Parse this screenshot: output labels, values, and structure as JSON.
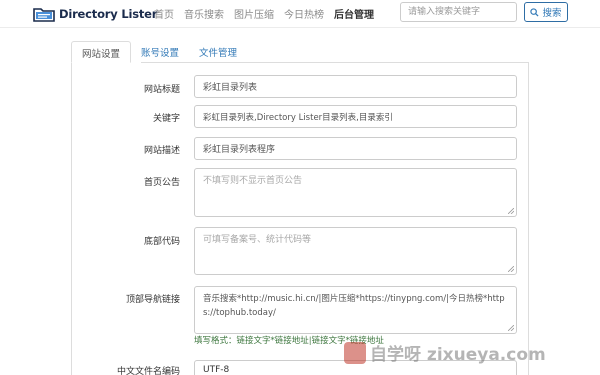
{
  "app": {
    "title": "Directory Lister"
  },
  "nav": {
    "items": [
      {
        "label": "首页",
        "active": false
      },
      {
        "label": "音乐搜索",
        "active": false
      },
      {
        "label": "图片压缩",
        "active": false
      },
      {
        "label": "今日热榜",
        "active": false
      },
      {
        "label": "后台管理",
        "active": true
      }
    ]
  },
  "search": {
    "placeholder": "请输入搜索关键字",
    "button_label": "搜索"
  },
  "tabs": [
    {
      "label": "网站设置",
      "active": true
    },
    {
      "label": "账号设置",
      "active": false
    },
    {
      "label": "文件管理",
      "active": false
    }
  ],
  "form": {
    "site_title": {
      "label": "网站标题",
      "value": "彩虹目录列表"
    },
    "keywords": {
      "label": "关键字",
      "value": "彩虹目录列表,Directory Lister目录列表,目录索引"
    },
    "description": {
      "label": "网站描述",
      "value": "彩虹目录列表程序"
    },
    "announcement": {
      "label": "首页公告",
      "placeholder": "不填写则不显示首页公告"
    },
    "footer_code": {
      "label": "底部代码",
      "placeholder": "可填写备案号、统计代码等"
    },
    "top_nav_links": {
      "label": "顶部导航链接",
      "value": "音乐搜索*http://music.hi.cn/|图片压缩*https://tinypng.com/|今日热榜*https://tophub.today/",
      "help": "填写格式：链接文字*链接地址|链接文字*链接地址"
    },
    "filename_encoding": {
      "label": "中文文件名编码",
      "value": "UTF-8"
    }
  },
  "watermark": {
    "text": "自学呀 zixueya.com"
  },
  "colors": {
    "link": "#337ab7",
    "help": "#3c763d",
    "border": "#cccccc",
    "logo_text": "#1a2b4c"
  }
}
